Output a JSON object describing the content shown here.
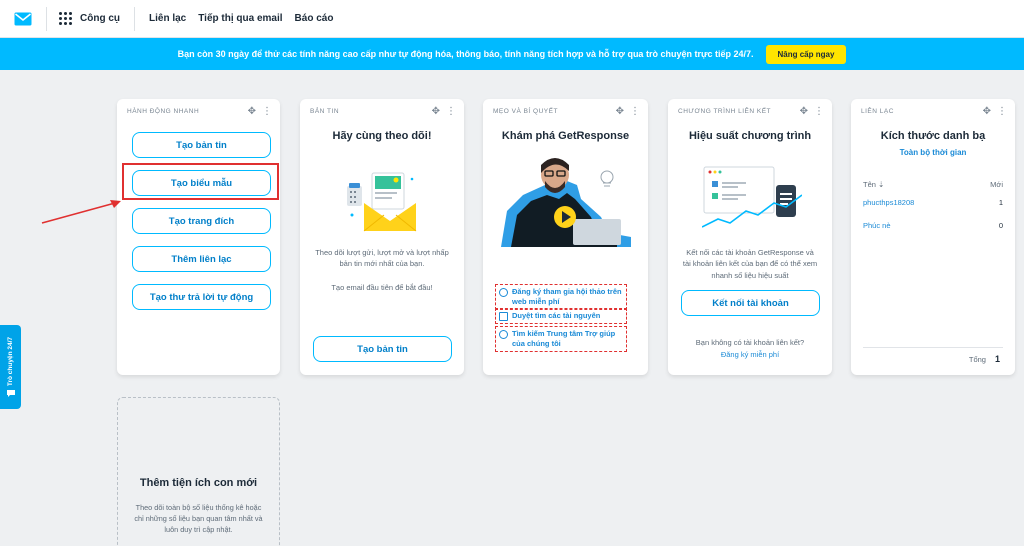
{
  "nav": {
    "tools_label": "Công cụ",
    "links": [
      "Liên lạc",
      "Tiếp thị qua email",
      "Báo cáo"
    ]
  },
  "banner": {
    "text": "Bạn còn 30 ngày để thử các tính năng cao cấp như tự động hóa, thông báo, tính năng tích hợp và hỗ trợ qua trò chuyện trực tiếp 24/7.",
    "button": "Nâng cấp ngay"
  },
  "side_tab": {
    "label": "Trò chuyện 24/7"
  },
  "quick_actions": {
    "header": "HÀNH ĐỘNG NHANH",
    "buttons": [
      "Tạo bản tin",
      "Tạo biểu mẫu",
      "Tạo trang đích",
      "Thêm liên lạc",
      "Tạo thư trả lời tự động"
    ]
  },
  "newsletter": {
    "header": "BẢN TIN",
    "title": "Hãy cùng theo dõi!",
    "desc": "Theo dõi lượt gửi, lượt mở và lượt nhấp bản tin mới nhất của bạn.",
    "desc2": "Tạo email đầu tiên để bắt đầu!",
    "button": "Tạo bản tin"
  },
  "tips": {
    "header": "MẸO VÀ BÍ QUYẾT",
    "title": "Khám phá GetResponse",
    "links": [
      "Đăng ký tham gia hội thảo trên web miễn phí",
      "Duyệt tìm các tài nguyên",
      "Tìm kiếm Trung tâm Trợ giúp của chúng tôi"
    ]
  },
  "affiliate": {
    "header": "CHƯƠNG TRÌNH LIÊN KẾT",
    "title": "Hiệu suất chương trình",
    "desc": "Kết nối các tài khoản GetResponse và tài khoản liên kết của bạn để có thể xem nhanh số liệu hiệu suất",
    "button": "Kết nối tài khoản",
    "question": "Bạn không có tài khoản liên kết?",
    "signup": "Đăng ký miễn phí"
  },
  "contacts": {
    "header": "LIÊN LẠC",
    "title": "Kích thước danh bạ",
    "period": "Toàn bộ thời gian",
    "col_name": "Tên ⇣",
    "col_new": "Mới",
    "rows": [
      {
        "name": "phucthps18208",
        "count": "1"
      },
      {
        "name": "Phúc nè",
        "count": "0"
      }
    ],
    "total_label": "Tổng",
    "total_value": "1"
  },
  "new_widget": {
    "title": "Thêm tiện ích con mới",
    "desc": "Theo dõi toàn bộ số liệu thống kê hoặc chỉ những số liệu bạn quan tâm nhất và luôn duy trì cập nhật."
  },
  "colors": {
    "accent": "#00baff",
    "banner": "#00baff",
    "upgrade": "#ffe500",
    "highlight": "#e03030"
  }
}
